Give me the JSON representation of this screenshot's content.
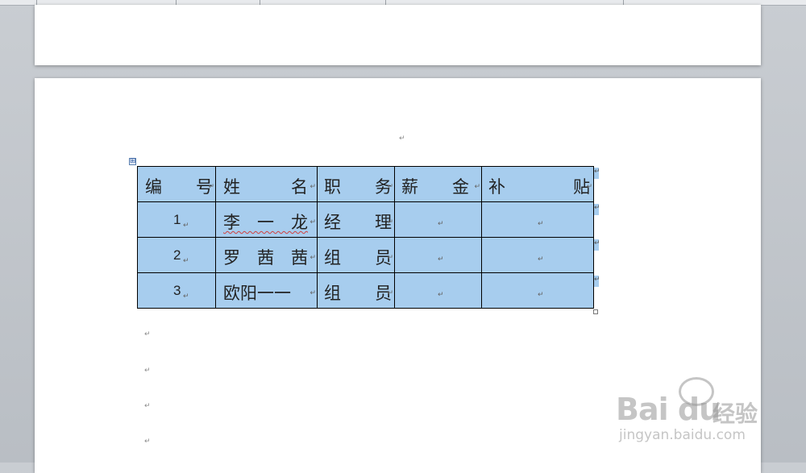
{
  "paragraph_mark": "↵",
  "table_move_icon": "⊞",
  "table": {
    "header": [
      "编　　号",
      "姓　　　名",
      "职　　务",
      "薪　　金",
      "补　　　　贴"
    ],
    "rows": [
      {
        "id": "1",
        "name": "李　一　龙",
        "title": "经　　理",
        "salary": "",
        "allowance": ""
      },
      {
        "id": "2",
        "name": "罗　茜　茜",
        "title": "组　　员",
        "salary": "",
        "allowance": ""
      },
      {
        "id": "3",
        "name": "欧阳一一",
        "title": "组　　员",
        "salary": "",
        "allowance": ""
      }
    ]
  },
  "watermark": {
    "brand": "Bai du",
    "brand_cn": "经验",
    "url": "jingyan.baidu.com"
  }
}
